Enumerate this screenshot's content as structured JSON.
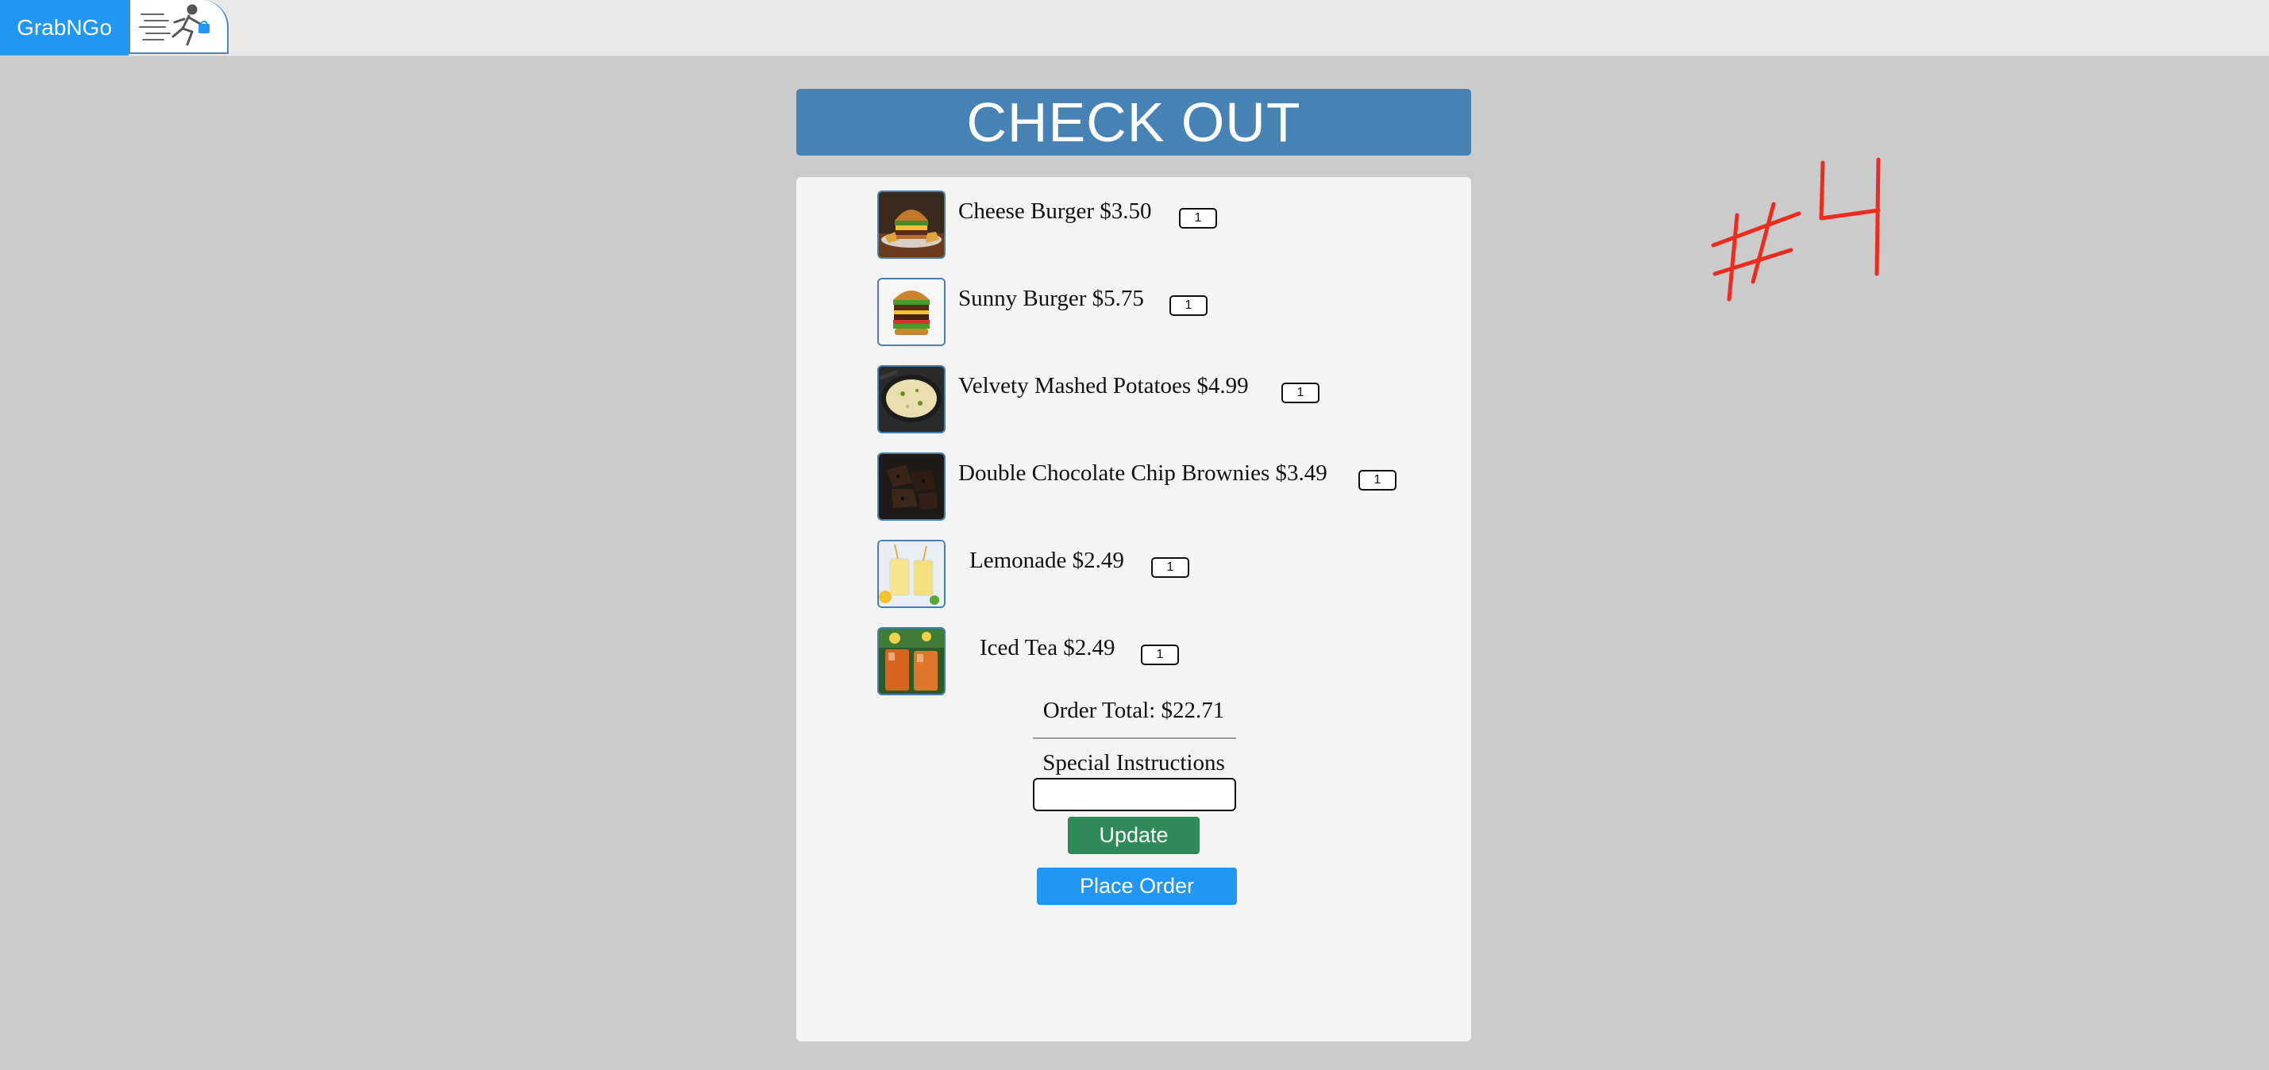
{
  "brand": "GrabNGo",
  "header_title": "CHECK OUT",
  "items": [
    {
      "label": "Cheese Burger $3.50",
      "qty": "1"
    },
    {
      "label": "Sunny Burger $5.75",
      "qty": "1"
    },
    {
      "label": "Velvety Mashed Potatoes $4.99",
      "qty": "1"
    },
    {
      "label": "Double Chocolate Chip Brownies $3.49",
      "qty": "1"
    },
    {
      "label": "Lemonade $2.49",
      "qty": "1"
    },
    {
      "label": "Iced Tea $2.49",
      "qty": "1"
    }
  ],
  "order_total": "Order Total: $22.71",
  "special_instructions_label": "Special Instructions",
  "special_instructions_value": "",
  "update_label": "Update",
  "place_order_label": "Place Order",
  "annotation": "#4",
  "colors": {
    "brand": "#2196f3",
    "header": "#4682b4",
    "update": "#2e8b57",
    "place_order": "#2196f3",
    "annotation": "#ee2b1c"
  }
}
